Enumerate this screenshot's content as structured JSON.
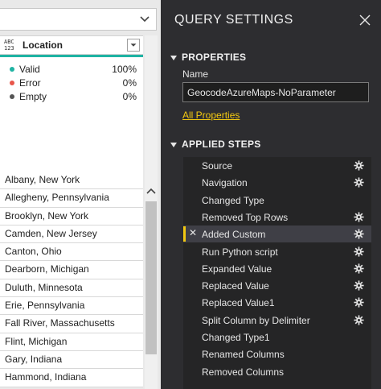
{
  "formula_bar": {
    "chevron_icon": "chevron-down-icon"
  },
  "column": {
    "type_icon_top": "ABC",
    "type_icon_bottom": "123",
    "name": "Location",
    "quality_color": "#1fb3a3"
  },
  "quality": [
    {
      "label": "Valid",
      "percent": "100%",
      "color": "#1fb3a3"
    },
    {
      "label": "Error",
      "percent": "0%",
      "color": "#e8564a"
    },
    {
      "label": "Empty",
      "percent": "0%",
      "color": "#555555"
    }
  ],
  "rows": [
    "Albany, New York",
    "Allegheny, Pennsylvania",
    "Brooklyn, New York",
    "Camden, New Jersey",
    "Canton, Ohio",
    "Dearborn, Michigan",
    "Duluth, Minnesota",
    "Erie, Pennsylvania",
    "Fall River, Massachusetts",
    "Flint, Michigan",
    "Gary, Indiana",
    "Hammond, Indiana"
  ],
  "query_settings": {
    "title": "QUERY SETTINGS",
    "close_icon": "close-icon",
    "properties": {
      "heading": "PROPERTIES",
      "name_label": "Name",
      "name_value": "GeocodeAzureMaps-NoParameter",
      "all_properties_link": "All Properties"
    },
    "applied_steps": {
      "heading": "APPLIED STEPS",
      "accent_color": "#f2c811",
      "steps": [
        {
          "label": "Source",
          "gear": true,
          "selected": false
        },
        {
          "label": "Navigation",
          "gear": true,
          "selected": false
        },
        {
          "label": "Changed Type",
          "gear": false,
          "selected": false
        },
        {
          "label": "Removed Top Rows",
          "gear": true,
          "selected": false
        },
        {
          "label": "Added Custom",
          "gear": true,
          "selected": true
        },
        {
          "label": "Run Python script",
          "gear": true,
          "selected": false
        },
        {
          "label": "Expanded Value",
          "gear": true,
          "selected": false
        },
        {
          "label": "Replaced Value",
          "gear": true,
          "selected": false
        },
        {
          "label": "Replaced Value1",
          "gear": true,
          "selected": false
        },
        {
          "label": "Split Column by Delimiter",
          "gear": true,
          "selected": false
        },
        {
          "label": "Changed Type1",
          "gear": false,
          "selected": false
        },
        {
          "label": "Renamed Columns",
          "gear": false,
          "selected": false
        },
        {
          "label": "Removed Columns",
          "gear": false,
          "selected": false
        }
      ]
    }
  }
}
